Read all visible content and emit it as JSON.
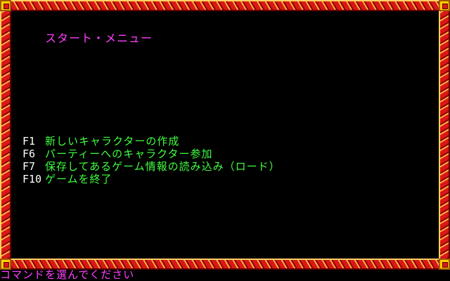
{
  "title": "スタート・メニュー",
  "menu": [
    {
      "key": "F1",
      "label": "新しいキャラクターの作成"
    },
    {
      "key": "F6",
      "label": "パーティーへのキャラクター参加"
    },
    {
      "key": "F7",
      "label": "保存してあるゲーム情報の読み込み（ロード）"
    },
    {
      "key": "F10",
      "label": "ゲームを終了"
    }
  ],
  "status": "コマンドを選んでください",
  "colors": {
    "title": "#ff40ff",
    "menu_text": "#40ff40",
    "menu_key": "#ffffff",
    "border": "#d81818",
    "border_highlight": "#ffb040",
    "corner": "#ffd000",
    "background": "#000000"
  }
}
